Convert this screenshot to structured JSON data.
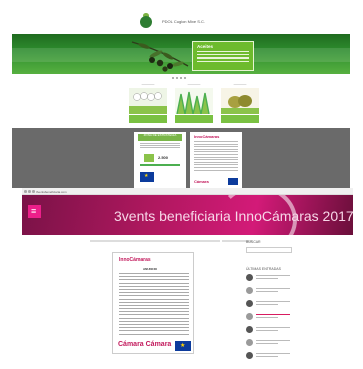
{
  "shot1": {
    "brand": "PDOL Cuglon Mixe S.C.",
    "badge_title": "Aceites",
    "poster_left": {
      "title": "ZONA DE ESTRATEGIA",
      "amount": "2.500"
    },
    "poster_right": {
      "head": "InnoCámaras",
      "foot": "Cámara"
    }
  },
  "shot2": {
    "url": "3ventsbeneficiaria.com",
    "title": "3vents beneficiaria InnoCámaras 2017",
    "menu_glyph": "≡",
    "poster": {
      "head": "InnoCámaras",
      "sub": "ANUNCIO",
      "foot": "Cámara Cámara"
    },
    "sidebar": {
      "search_heading": "BUSCAR",
      "recent_heading": "ÚLTIMAS ENTRADAS",
      "item_count": 7
    }
  },
  "colors": {
    "olive_green": "#2f8f2f",
    "lime": "#6dbb2d",
    "magenta": "#d31a78",
    "eu_blue": "#0c3b9c"
  }
}
